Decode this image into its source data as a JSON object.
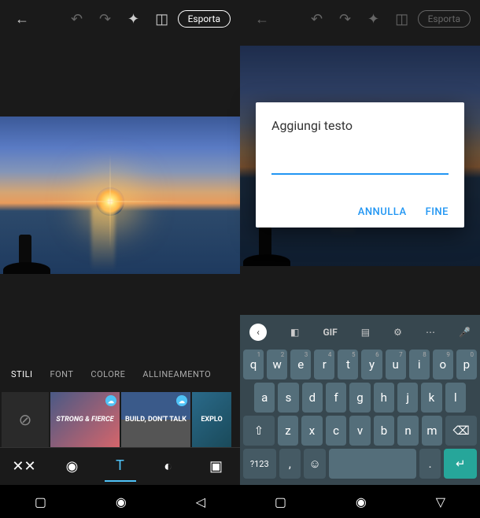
{
  "toolbar": {
    "export_label": "Esporta"
  },
  "tabs": {
    "styles": "STILI",
    "font": "FONT",
    "color": "COLORE",
    "alignment": "ALLINEAMENTO"
  },
  "style_cards": {
    "card1": "STRONG & FIERCE",
    "card2": "BUILD, DON'T TALK",
    "card3": "EXPLO"
  },
  "dialog": {
    "title": "Aggiungi testo",
    "input_value": "",
    "cancel": "ANNULLA",
    "done": "FINE"
  },
  "keyboard": {
    "suggest_gif": "GIF",
    "row1": [
      {
        "k": "q",
        "n": "1"
      },
      {
        "k": "w",
        "n": "2"
      },
      {
        "k": "e",
        "n": "3"
      },
      {
        "k": "r",
        "n": "4"
      },
      {
        "k": "t",
        "n": "5"
      },
      {
        "k": "y",
        "n": "6"
      },
      {
        "k": "u",
        "n": "7"
      },
      {
        "k": "i",
        "n": "8"
      },
      {
        "k": "o",
        "n": "9"
      },
      {
        "k": "p",
        "n": "0"
      }
    ],
    "row2": [
      "a",
      "s",
      "d",
      "f",
      "g",
      "h",
      "j",
      "k",
      "l"
    ],
    "row3": [
      "z",
      "x",
      "c",
      "v",
      "b",
      "n",
      "m"
    ],
    "shift": "⇧",
    "backspace": "⌫",
    "numbers": "?123",
    "comma": ",",
    "period": ".",
    "enter": "↵"
  }
}
